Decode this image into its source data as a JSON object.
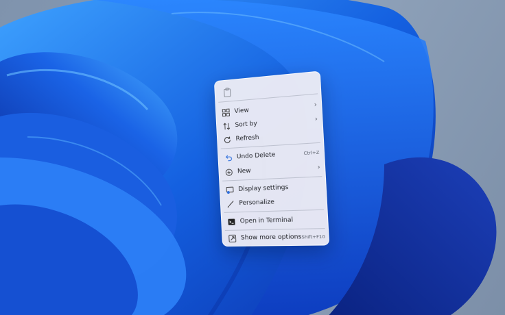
{
  "colors": {
    "wallpaper_bg": "#8a9db5",
    "bloom_dark": "#0b2fa8",
    "bloom_mid": "#1460e0",
    "bloom_light": "#3fa3ff",
    "menu_bg": "#f0eef4",
    "accent": "#2f6fdd"
  },
  "menu": {
    "top_icon": "paste-icon",
    "items": [
      {
        "icon": "view-grid-icon",
        "label": "View",
        "shortcut": "",
        "submenu": "›"
      },
      {
        "icon": "sort-arrows-icon",
        "label": "Sort by",
        "shortcut": "",
        "submenu": "›"
      },
      {
        "icon": "refresh-icon",
        "label": "Refresh",
        "shortcut": "",
        "submenu": ""
      },
      {
        "icon": "undo-icon",
        "label": "Undo Delete",
        "shortcut": "Ctrl+Z",
        "submenu": ""
      },
      {
        "icon": "new-plus-icon",
        "label": "New",
        "shortcut": "",
        "submenu": "›"
      },
      {
        "icon": "display-settings-icon",
        "label": "Display settings",
        "shortcut": "",
        "submenu": ""
      },
      {
        "icon": "personalize-brush-icon",
        "label": "Personalize",
        "shortcut": "",
        "submenu": ""
      },
      {
        "icon": "terminal-icon",
        "label": "Open in Terminal",
        "shortcut": "",
        "submenu": ""
      },
      {
        "icon": "more-options-icon",
        "label": "Show more options",
        "shortcut": "Shift+F10",
        "submenu": ""
      }
    ]
  }
}
